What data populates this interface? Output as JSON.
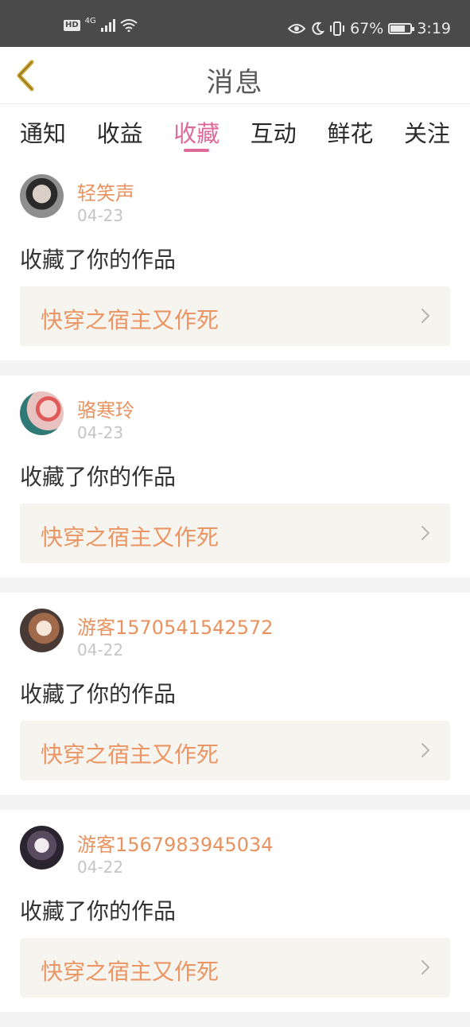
{
  "status_bar": {
    "hd_label": "HD",
    "network_label": "4G",
    "battery_percent_text": "67%",
    "battery_level": 0.67,
    "time": "3:19"
  },
  "header": {
    "title": "消息",
    "back_icon": "chevron-left-icon",
    "back_color": "#c9a227"
  },
  "tabs": [
    {
      "label": "通知",
      "active": false
    },
    {
      "label": "收益",
      "active": false
    },
    {
      "label": "收藏",
      "active": true
    },
    {
      "label": "互动",
      "active": false
    },
    {
      "label": "鲜花",
      "active": false
    },
    {
      "label": "关注",
      "active": false
    }
  ],
  "colors": {
    "accent": "#e0699c",
    "username": "#e8935f",
    "work_title": "#eb9564",
    "work_bg": "#f6f4ee"
  },
  "messages": [
    {
      "username": "轻笑声",
      "date": "04-23",
      "action": "收藏了你的作品",
      "work_title": "快穿之宿主又作死"
    },
    {
      "username": "骆寒玲",
      "date": "04-23",
      "action": "收藏了你的作品",
      "work_title": "快穿之宿主又作死"
    },
    {
      "username": "游客1570541542572",
      "date": "04-22",
      "action": "收藏了你的作品",
      "work_title": "快穿之宿主又作死"
    },
    {
      "username": "游客1567983945034",
      "date": "04-22",
      "action": "收藏了你的作品",
      "work_title": "快穿之宿主又作死"
    }
  ]
}
